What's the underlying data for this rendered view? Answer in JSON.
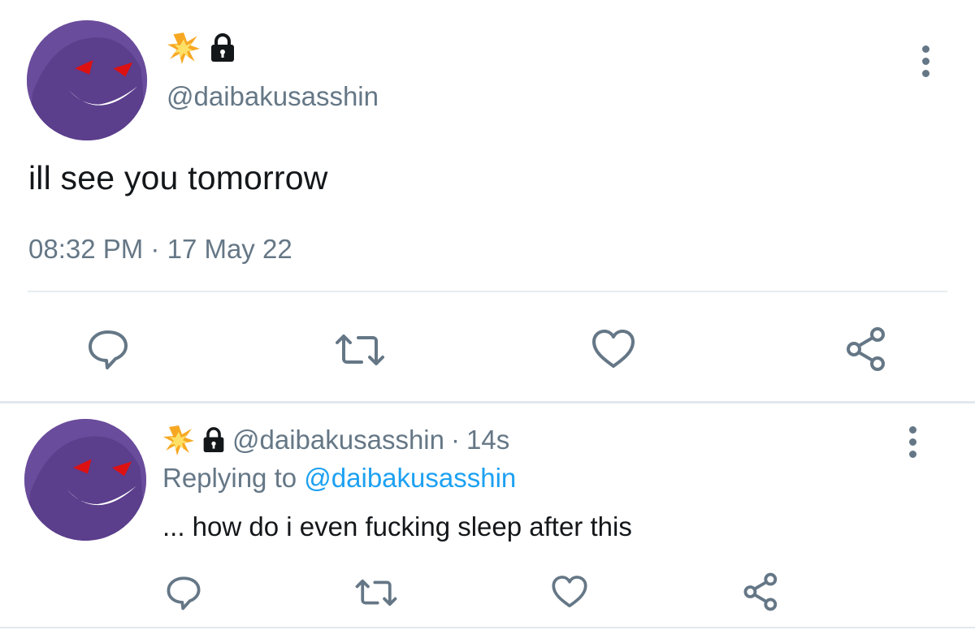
{
  "main_tweet": {
    "handle": "@daibakusasshin",
    "text": "ill see you tomorrow",
    "time": "08:32 PM",
    "dot": "·",
    "date": "17 May 22"
  },
  "reply_tweet": {
    "handle": "@daibakusasshin",
    "dot": "·",
    "age": "14s",
    "replying_prefix": "Replying to",
    "replying_handle": "@daibakusasshin",
    "text": "... how do i even fucking sleep after this"
  },
  "icons": {
    "badge": "collision-emoji-icon",
    "lock": "lock-icon",
    "reply": "reply-icon",
    "retweet": "retweet-icon",
    "like": "heart-icon",
    "share": "share-icon",
    "more": "more-vertical-icon"
  },
  "colors": {
    "text": "#14171a",
    "secondary": "#657786",
    "link": "#1da1f2",
    "avatar": "#6a4c9c",
    "divider": "#e6ecf0"
  }
}
